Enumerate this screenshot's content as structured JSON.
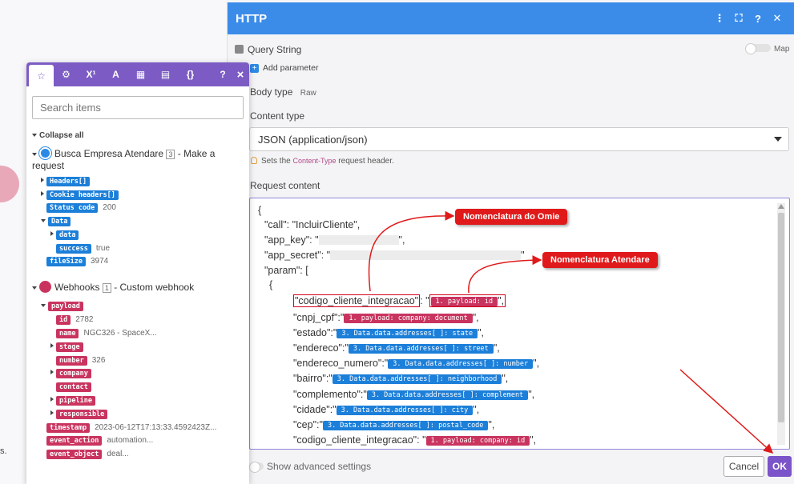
{
  "background": {
    "snippet": "s."
  },
  "http_modal": {
    "title": "HTTP",
    "query_string_label": "Query String",
    "map_label": "Map",
    "add_parameter": "Add parameter",
    "body_type_label": "Body type",
    "body_type_value": "Raw",
    "content_type_label": "Content type",
    "content_type_value": "JSON (application/json)",
    "tip_prefix": "Sets the",
    "tip_code": "Content-Type",
    "tip_suffix": "request header.",
    "request_content_label": "Request content",
    "show_advanced": "Show advanced settings",
    "cancel_label": "Cancel",
    "ok_label": "OK"
  },
  "code": {
    "l1": "{",
    "l2": "\"call\": \"IncluirCliente\",",
    "l3a": "\"app_key\": \"",
    "l3b": "\",",
    "l4a": "\"app_secret\": \"",
    "l4b": "\"",
    "l5": "\"param\": [",
    "l6": "{",
    "codigo_key": "\"codigo_cliente_integracao\"",
    "codigo_sep": ": \"",
    "codigo_pill": "1. payload: id",
    "codigo_end": "\",",
    "cnpj_key": "\"cnpj_cpf\":\"",
    "cnpj_pill": "1. payload: company: document",
    "cnpj_end": "\",",
    "estado_key": "\"estado\":\"",
    "estado_pill": "3. Data.data.addresses[ ]: state",
    "estado_end": "\",",
    "endereco_key": "\"endereco\":\"",
    "endereco_pill": "3. Data.data.addresses[ ]: street",
    "endereco_end": "\",",
    "numero_key": "\"endereco_numero\":\"",
    "numero_pill": "3. Data.data.addresses[ ]: number",
    "numero_end": "\",",
    "bairro_key": "\"bairro\":\"",
    "bairro_pill": "3. Data.data.addresses[ ]: neighborhood",
    "bairro_end": "\",",
    "complemento_key": "\"complemento\":\"",
    "complemento_pill": "3. Data.data.addresses[ ]: complement",
    "complemento_end": "\",",
    "cidade_key": "\"cidade\":\"",
    "cidade_pill": "3. Data.data.addresses[ ]: city",
    "cidade_end": "\",",
    "cep_key": "\"cep\":\"",
    "cep_pill": "3. Data.data.addresses[ ]: postal_code",
    "cep_end": "\",",
    "codigo2_key": "\"codigo_cliente_integracao\": \"",
    "codigo2_pill": "1. payload: company: id",
    "codigo2_end": "\","
  },
  "annotations": {
    "omie": "Nomenclatura do Omie",
    "atendare": "Nomenclatura Atendare"
  },
  "panel": {
    "tabs": [
      "☆",
      "⚙",
      "X¹",
      "A",
      "▦",
      "▤",
      "{}"
    ],
    "help": "?",
    "close": "×",
    "search_placeholder": "Search items",
    "collapse_all": "Collapse all",
    "module1": {
      "name": "Busca Empresa Atendare",
      "num": "3",
      "desc": "- Make a request"
    },
    "module1_items": {
      "headers": "Headers[]",
      "cookie": "Cookie headers[]",
      "status": "Status code",
      "status_val": "200",
      "data": "Data",
      "data_sub": "data",
      "success": "success",
      "success_val": "true",
      "filesize": "fileSize",
      "filesize_val": "3974"
    },
    "module2": {
      "name": "Webhooks",
      "num": "1",
      "desc": "- Custom webhook"
    },
    "module2_items": {
      "payload": "payload",
      "id": "id",
      "id_val": "2782",
      "name": "name",
      "name_val": "NGC326 - SpaceX...",
      "stage": "stage",
      "number": "number",
      "number_val": "326",
      "company": "company",
      "contact": "contact",
      "pipeline": "pipeline",
      "responsible": "responsible",
      "timestamp": "timestamp",
      "timestamp_val": "2023-06-12T17:13:33.4592423Z...",
      "event_action": "event_action",
      "event_action_val": "automation...",
      "event_object": "event_object",
      "event_object_val": "deal..."
    }
  }
}
